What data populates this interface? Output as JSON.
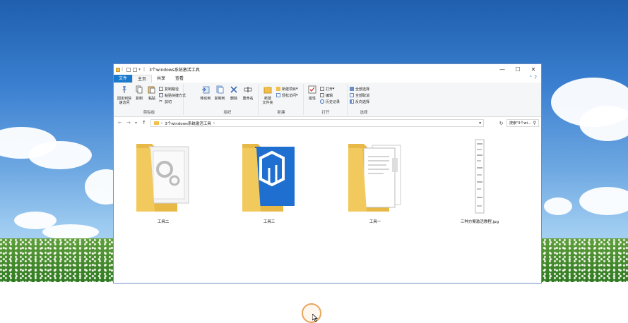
{
  "window": {
    "title": "3个windows系统激活工具",
    "controls": {
      "minimize": "—",
      "maximize": "☐",
      "close": "✕"
    }
  },
  "tabs": [
    {
      "label": "文件"
    },
    {
      "label": "主页"
    },
    {
      "label": "共享"
    },
    {
      "label": "查看"
    }
  ],
  "ribbon": {
    "clipboard": {
      "label": "剪贴板",
      "pin": "固定到快\n速访问",
      "copy": "复制",
      "paste": "粘贴",
      "copy_path": "复制路径",
      "paste_shortcut": "粘贴快捷方式",
      "cut": "剪切"
    },
    "organize": {
      "label": "组织",
      "move_to": "移动到",
      "copy_to": "复制到",
      "delete": "删除",
      "rename": "重命名"
    },
    "new": {
      "label": "新建",
      "new_folder": "新建\n文件夹",
      "new_item": "新建项目",
      "easy_access": "轻松访问"
    },
    "open": {
      "label": "打开",
      "properties": "属性",
      "open": "打开",
      "edit": "编辑",
      "history": "历史记录"
    },
    "select": {
      "label": "选择",
      "select_all": "全部选择",
      "select_none": "全部取消",
      "invert": "反向选择"
    }
  },
  "address": {
    "path": "3个windows系统激活工具",
    "search_placeholder": "搜索\"3个wi..."
  },
  "files": [
    {
      "name": "工具二",
      "type": "folder-gear"
    },
    {
      "name": "工具三",
      "type": "folder-blue"
    },
    {
      "name": "工具一",
      "type": "folder-docs"
    },
    {
      "name": "三种方案激活教程.jpg",
      "type": "image-file"
    }
  ],
  "colors": {
    "accent": "#1979ca",
    "folder": "#f2c04a",
    "cursor_ring": "#e8a65c"
  }
}
